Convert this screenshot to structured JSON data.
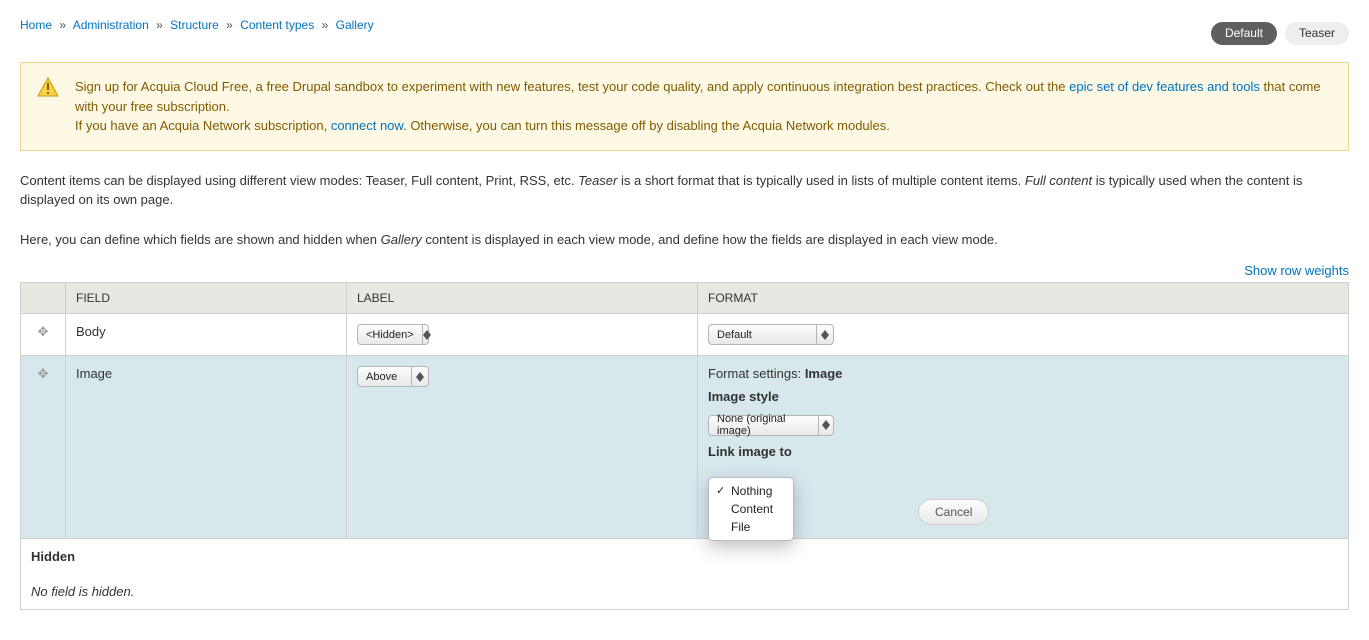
{
  "breadcrumb": [
    "Home",
    "Administration",
    "Structure",
    "Content types",
    "Gallery"
  ],
  "tabs": [
    {
      "label": "Default",
      "active": true
    },
    {
      "label": "Teaser",
      "active": false
    }
  ],
  "message": {
    "line1_pre": "Sign up for Acquia Cloud Free, a free Drupal sandbox to experiment with new features, test your code quality, and apply continuous integration best practices. Check out the ",
    "link1": "epic set of dev features and tools",
    "line1_post": " that come with your free subscription.",
    "line2_pre": "If you have an Acquia Network subscription, ",
    "link2": "connect now",
    "line2_post": ". Otherwise, you can turn this message off by disabling the Acquia Network modules."
  },
  "description": {
    "t1": "Content items can be displayed using different view modes: Teaser, Full content, Print, RSS, etc. ",
    "em1": "Teaser",
    "t2": " is a short format that is typically used in lists of multiple content items. ",
    "em2": "Full content",
    "t3": " is typically used when the content is displayed on its own page.",
    "t4": "Here, you can define which fields are shown and hidden when ",
    "em3": "Gallery",
    "t5": " content is displayed in each view mode, and define how the fields are displayed in each view mode."
  },
  "show_row_weights": "Show row weights",
  "table": {
    "headers": {
      "field": "FIELD",
      "label": "LABEL",
      "format": "FORMAT"
    },
    "rows": {
      "body": {
        "field": "Body",
        "label_select": "<Hidden>",
        "format_select": "Default"
      },
      "image": {
        "field": "Image",
        "label_select": "Above",
        "format_settings_prefix": "Format settings: ",
        "format_settings_value": "Image",
        "image_style_label": "Image style",
        "image_style_select": "None (original image)",
        "link_image_label": "Link image to",
        "link_options": [
          "Nothing",
          "Content",
          "File"
        ],
        "link_selected": "Nothing",
        "cancel": "Cancel"
      }
    },
    "hidden_title": "Hidden",
    "hidden_text": "No field is hidden."
  }
}
